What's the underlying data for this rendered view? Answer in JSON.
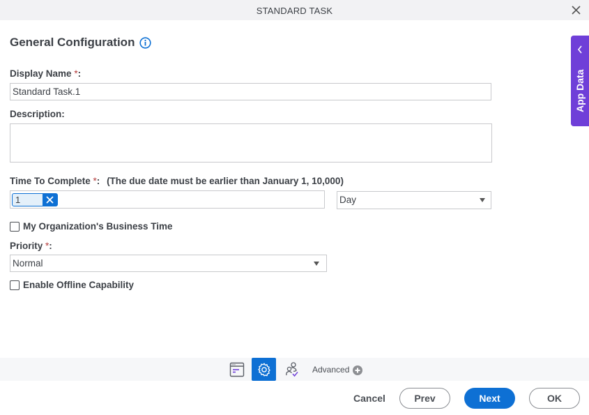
{
  "window": {
    "title": "STANDARD TASK",
    "close_icon": "close-icon"
  },
  "form": {
    "heading": "General Configuration",
    "info_icon": "info-icon",
    "display_name": {
      "label": "Display Name",
      "required_mark": "*",
      "colon": ":",
      "value": "Standard Task.1"
    },
    "description": {
      "label": "Description:",
      "value": ""
    },
    "time_to_complete": {
      "label": "Time To Complete",
      "required_mark": "*",
      "colon": ":",
      "hint": "(The due date must be earlier than January 1, 10,000)",
      "token_value": "1",
      "unit_selected": "Day"
    },
    "business_time": {
      "label": "My Organization's Business Time",
      "checked": false
    },
    "priority": {
      "label": "Priority",
      "required_mark": "*",
      "colon": ":",
      "selected": "Normal"
    },
    "offline": {
      "label": "Enable Offline Capability",
      "checked": false
    }
  },
  "side_panel": {
    "label": "App Data",
    "icon": "chevron-left-icon",
    "color": "#6f3fd8"
  },
  "toolbar": {
    "items": [
      {
        "name": "form-properties-icon"
      },
      {
        "name": "gear-icon",
        "active": true
      },
      {
        "name": "participants-icon"
      }
    ],
    "advanced_label": "Advanced",
    "advanced_icon": "plus-circle-icon",
    "accent": "#0e70d4"
  },
  "footer": {
    "cancel": "Cancel",
    "prev": "Prev",
    "next": "Next",
    "ok": "OK"
  }
}
